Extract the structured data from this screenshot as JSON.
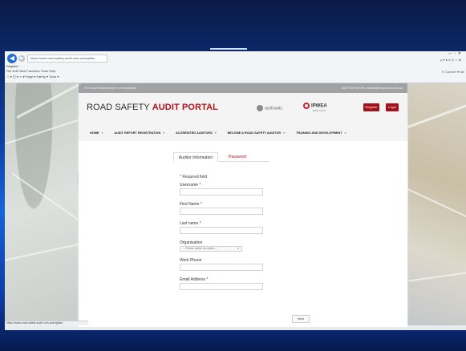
{
  "browser": {
    "address": "https://www.road-safety-audit.com.au/register",
    "tab_title": "Register",
    "menu": "File  Edit  View  Favorites  Tools  Help",
    "toolbar": "☆ ▾ ◫ ▾ ▭ ▾ Page ▾  Safety ▾  Tools ▾",
    "right_tools": "ρ ▾ ♠ ¢   ◎ ☆ ⊗",
    "right_tools2": "✕  Convert ▾  Sel",
    "status_url": "https://www.road-safety-audit.com.au/register"
  },
  "site": {
    "tagline": "For road infrastructure professionals",
    "top_info": "1800 000 000   ✉ contact@rsaportal.com.au",
    "logo_plain": "ROAD SAFETY ",
    "logo_bold": "AUDIT PORTAL",
    "partner1": "austroads",
    "partner2_name": "IPWEA",
    "partner2_sub": "NSW & ACT",
    "register_label": "Register",
    "login_label": "Login",
    "nav": [
      {
        "label": "HOME"
      },
      {
        "label": "AUDIT REPORT REGISTRATION"
      },
      {
        "label": "ACCREDITED AUDITORS"
      },
      {
        "label": "BECOME A ROAD SAFETY AUDITOR"
      },
      {
        "label": "TRAINING AND DEVELOPMENT"
      }
    ]
  },
  "form": {
    "tabs": [
      "Auditor Information",
      "Password"
    ],
    "required_note": "Required field",
    "fields": {
      "username": "Username",
      "first_name": "First Name",
      "last_name": "Last name",
      "organisation": "Organisation",
      "organisation_placeholder": "-- Please select an option --",
      "work_phone": "Work Phone",
      "email": "Email Address"
    },
    "next_label": "Next"
  }
}
